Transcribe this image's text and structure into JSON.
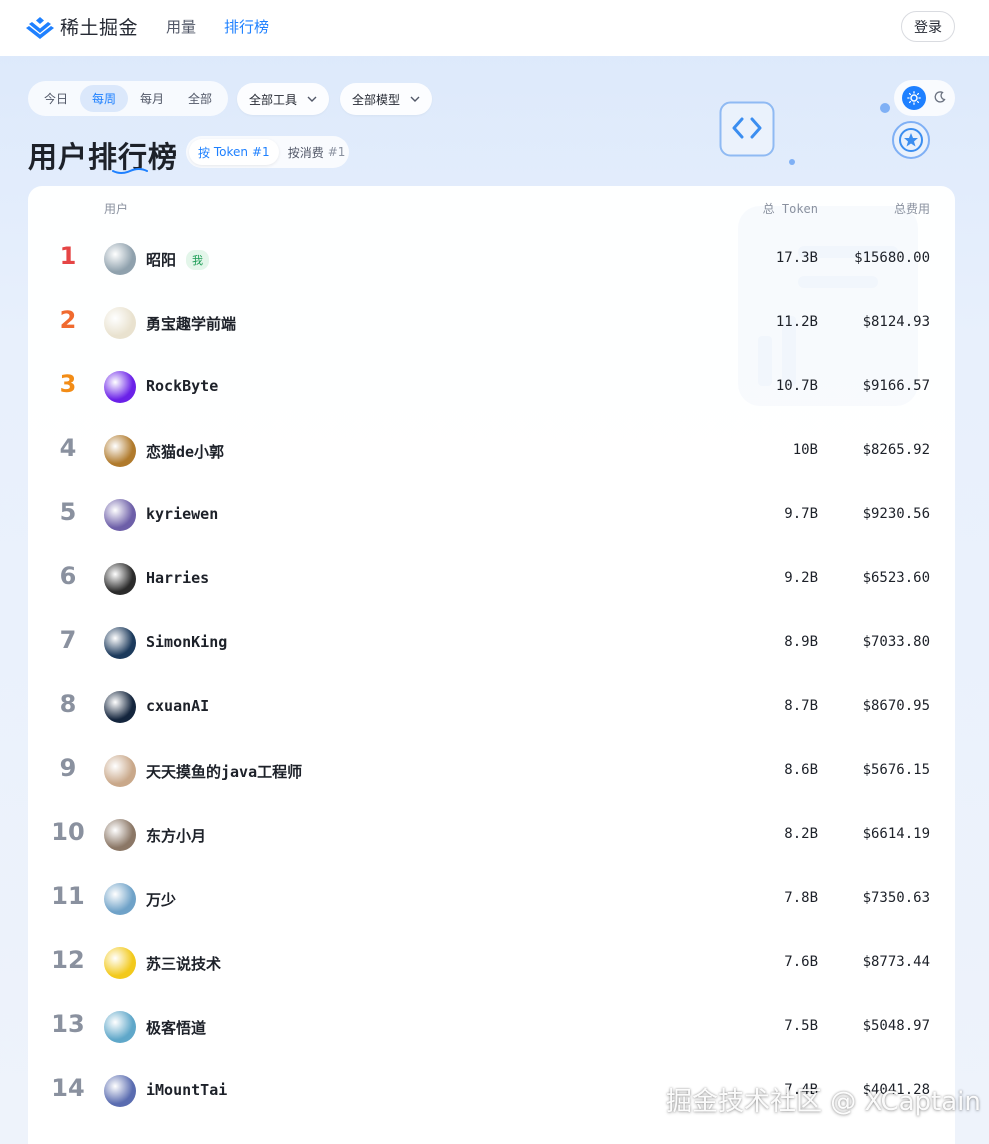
{
  "nav": {
    "logo_text": "稀土掘金",
    "links": [
      "用量",
      "排行榜"
    ],
    "active_link": "排行榜",
    "login_label": "登录"
  },
  "filters": {
    "time_ranges": [
      "今日",
      "每周",
      "每月",
      "全部"
    ],
    "active_time_range": "每周",
    "tool_dropdown": "全部工具",
    "model_dropdown": "全部模型"
  },
  "theme_toggle": {
    "active": "light"
  },
  "page_title": "用户排行榜",
  "sort": {
    "by_token_prefix": "按",
    "by_token_label": "Token",
    "by_token_rank": "#1",
    "by_cost_label": "按消费",
    "by_cost_rank": "#1",
    "active": "token"
  },
  "table": {
    "headers": {
      "user": "用户",
      "total_token": "总 Token",
      "total_cost": "总费用"
    },
    "rows": [
      {
        "rank": "1",
        "name": "昭阳",
        "badge": "我",
        "tokens": "17.3B",
        "cost": "$15680.00",
        "avatar_color": "#8fa1ad"
      },
      {
        "rank": "2",
        "name": "勇宝趣学前端",
        "tokens": "11.2B",
        "cost": "$8124.93",
        "avatar_color": "#e9e2cf"
      },
      {
        "rank": "3",
        "name": "RockByte",
        "tokens": "10.7B",
        "cost": "$9166.57",
        "avatar_color": "#6a21e8"
      },
      {
        "rank": "4",
        "name": "恋猫de小郭",
        "tokens": "10B",
        "cost": "$8265.92",
        "avatar_color": "#b07a2c"
      },
      {
        "rank": "5",
        "name": "kyriewen",
        "tokens": "9.7B",
        "cost": "$9230.56",
        "avatar_color": "#6d5fa8"
      },
      {
        "rank": "6",
        "name": "Harries",
        "tokens": "9.2B",
        "cost": "$6523.60",
        "avatar_color": "#2b2b2b"
      },
      {
        "rank": "7",
        "name": "SimonKing",
        "tokens": "8.9B",
        "cost": "$7033.80",
        "avatar_color": "#1c3a5c"
      },
      {
        "rank": "8",
        "name": "cxuanAI",
        "tokens": "8.7B",
        "cost": "$8670.95",
        "avatar_color": "#14253d"
      },
      {
        "rank": "9",
        "name": "天天摸鱼的java工程师",
        "tokens": "8.6B",
        "cost": "$5676.15",
        "avatar_color": "#c9a88a"
      },
      {
        "rank": "10",
        "name": "东方小月",
        "tokens": "8.2B",
        "cost": "$6614.19",
        "avatar_color": "#8b7766"
      },
      {
        "rank": "11",
        "name": "万少",
        "tokens": "7.8B",
        "cost": "$7350.63",
        "avatar_color": "#6fa2c8"
      },
      {
        "rank": "12",
        "name": "苏三说技术",
        "tokens": "7.6B",
        "cost": "$8773.44",
        "avatar_color": "#f2c91c"
      },
      {
        "rank": "13",
        "name": "极客悟道",
        "tokens": "7.5B",
        "cost": "$5048.97",
        "avatar_color": "#5fa7c9"
      },
      {
        "rank": "14",
        "name": "iMountTai",
        "tokens": "7.4B",
        "cost": "$4041.28",
        "avatar_color": "#5a6cb0"
      }
    ]
  },
  "watermark": "掘金技术社区 @ XCaptain",
  "colors": {
    "accent": "#1e80ff",
    "rank1": "#e54545",
    "rank2": "#f06a2f",
    "rank3": "#f28c16",
    "me_badge": "#1a9c54"
  }
}
